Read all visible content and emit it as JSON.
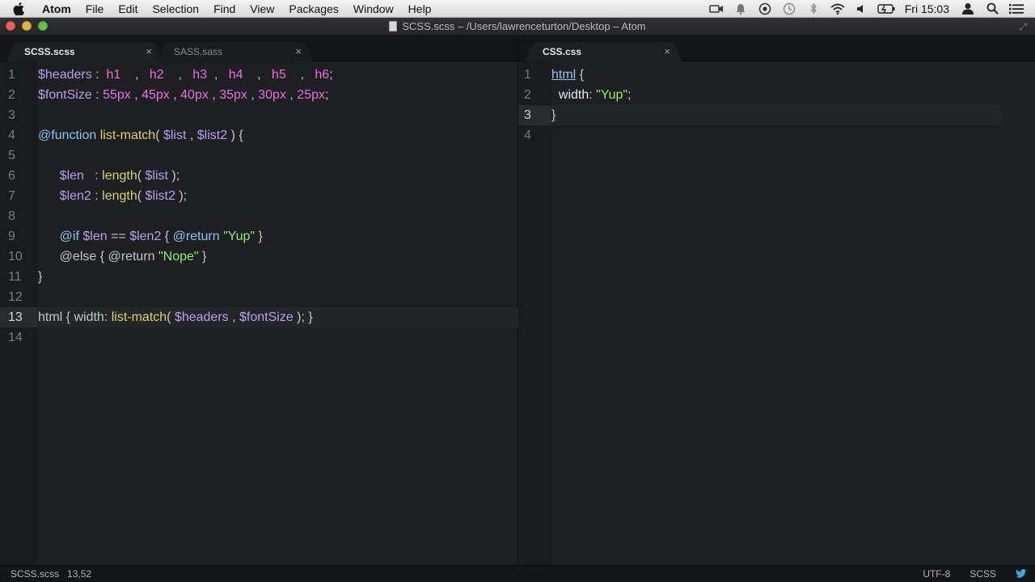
{
  "menubar": {
    "app_name": "Atom",
    "items": [
      "File",
      "Edit",
      "Selection",
      "Find",
      "View",
      "Packages",
      "Window",
      "Help"
    ],
    "clock": "Fri 15:03"
  },
  "window": {
    "title": "SCSS.scss – /Users/lawrenceturton/Desktop – Atom"
  },
  "left_pane": {
    "tabs": [
      {
        "label": "SCSS.scss",
        "active": true
      },
      {
        "label": "SASS.sass",
        "active": false
      }
    ],
    "line_numbers": [
      "1",
      "2",
      "3",
      "4",
      "5",
      "6",
      "7",
      "8",
      "9",
      "10",
      "11",
      "12",
      "13",
      "14"
    ],
    "current_line": 13
  },
  "right_pane": {
    "tabs": [
      {
        "label": "CSS.css",
        "active": true
      }
    ],
    "line_numbers": [
      "1",
      "2",
      "3",
      "4"
    ],
    "current_line": 3
  },
  "statusbar": {
    "file": "SCSS.scss",
    "cursor": "13,52",
    "encoding": "UTF-8",
    "grammar": "SCSS"
  },
  "colors": {
    "editor_bg": "#1d1f21",
    "variable": "#b9a0f2",
    "number": "#ef6de6",
    "keyword": "#86c6f4",
    "function": "#d8d36e",
    "string": "#8ef06e"
  }
}
